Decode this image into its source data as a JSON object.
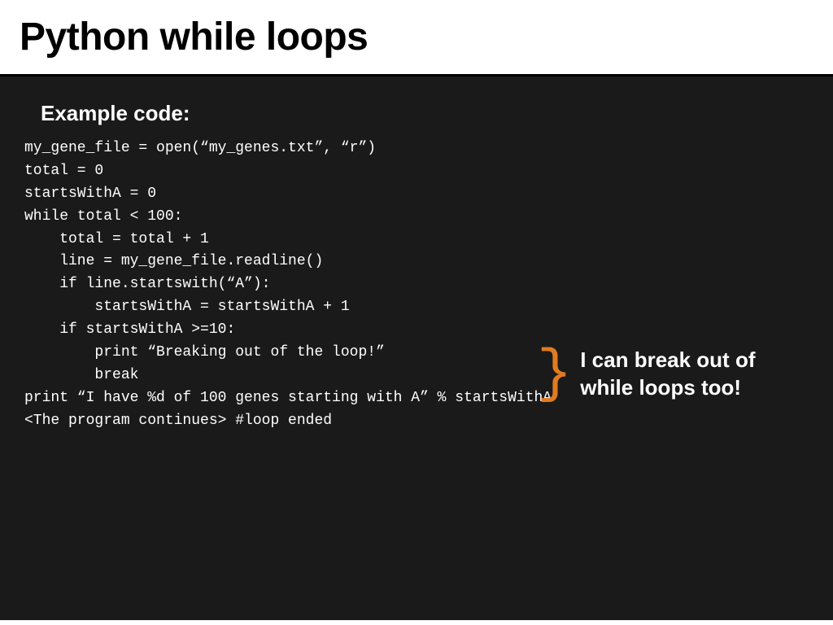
{
  "header": {
    "title": "Python while loops"
  },
  "content": {
    "example_label": "Example code:",
    "code_lines": [
      "my_gene_file = open(“my_genes.txt”, “r”)",
      "",
      "total = 0",
      "startsWithA = 0",
      "while total < 100:",
      "    total = total + 1",
      "    line = my_gene_file.readline()",
      "    if line.startswith(“A”):",
      "        startsWithA = startsWithA + 1",
      "    if startsWithA >=10:",
      "        print “Breaking out of the loop!”",
      "        break",
      "",
      "print “I have %d of 100 genes starting with A” % startsWithA",
      "<The program continues> #loop ended"
    ],
    "annotation": {
      "brace": "}",
      "text": "I can break out of while loops too!"
    }
  }
}
